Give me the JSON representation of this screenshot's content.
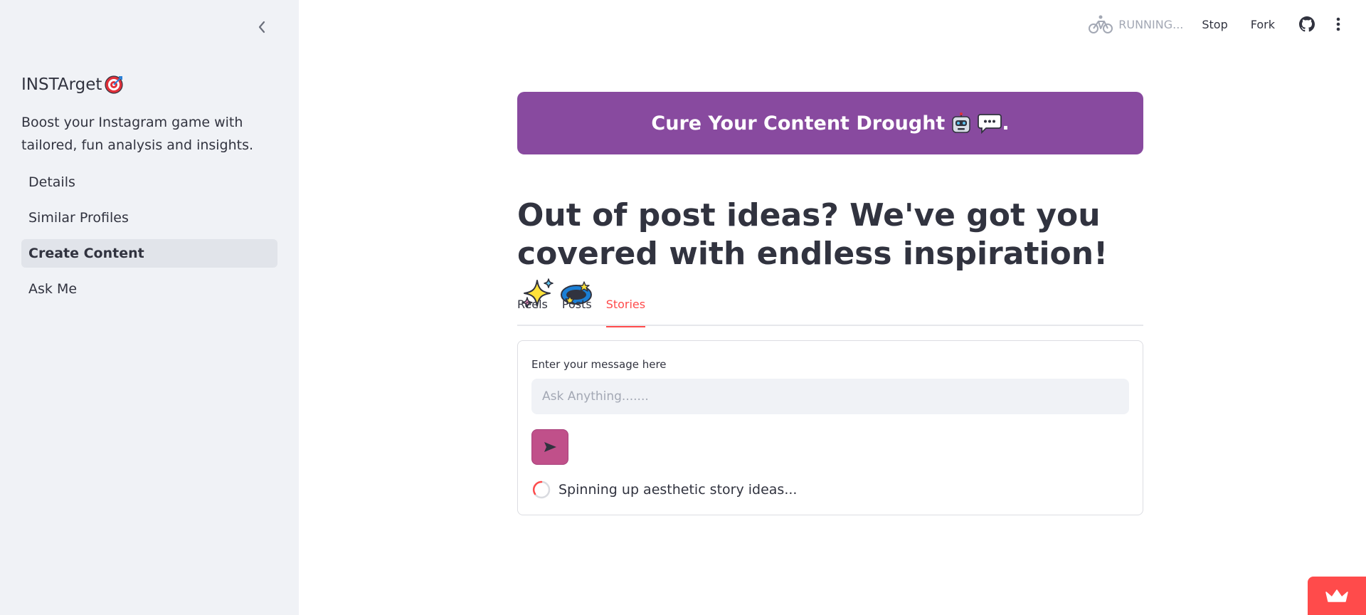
{
  "sidebar": {
    "brand": "INSTArget",
    "brand_emoji": "direct-hit-icon",
    "tagline": "Boost your Instagram game with tailored, fun analysis and insights.",
    "items": [
      {
        "label": "Details"
      },
      {
        "label": "Similar Profiles"
      },
      {
        "label": "Create Content",
        "active": true
      },
      {
        "label": "Ask Me"
      }
    ]
  },
  "toolbar": {
    "status": "RUNNING...",
    "stop_label": "Stop",
    "fork_label": "Fork"
  },
  "main": {
    "banner": {
      "text": "Cure Your Content Drought",
      "suffix": "."
    },
    "headline": "Out of post ideas? We've got you covered with endless inspiration!",
    "tabs": [
      {
        "label": "Reels"
      },
      {
        "label": "Posts"
      },
      {
        "label": "Stories",
        "active": true
      }
    ],
    "form": {
      "label": "Enter your message here",
      "placeholder": "Ask Anything.......",
      "spinner_text": "Spinning up aesthetic story ideas..."
    }
  },
  "colors": {
    "accent": "#ff4b4b",
    "banner": "#884a9f",
    "send_button": "#c0508a",
    "sidebar_bg": "#f0f2f6"
  }
}
